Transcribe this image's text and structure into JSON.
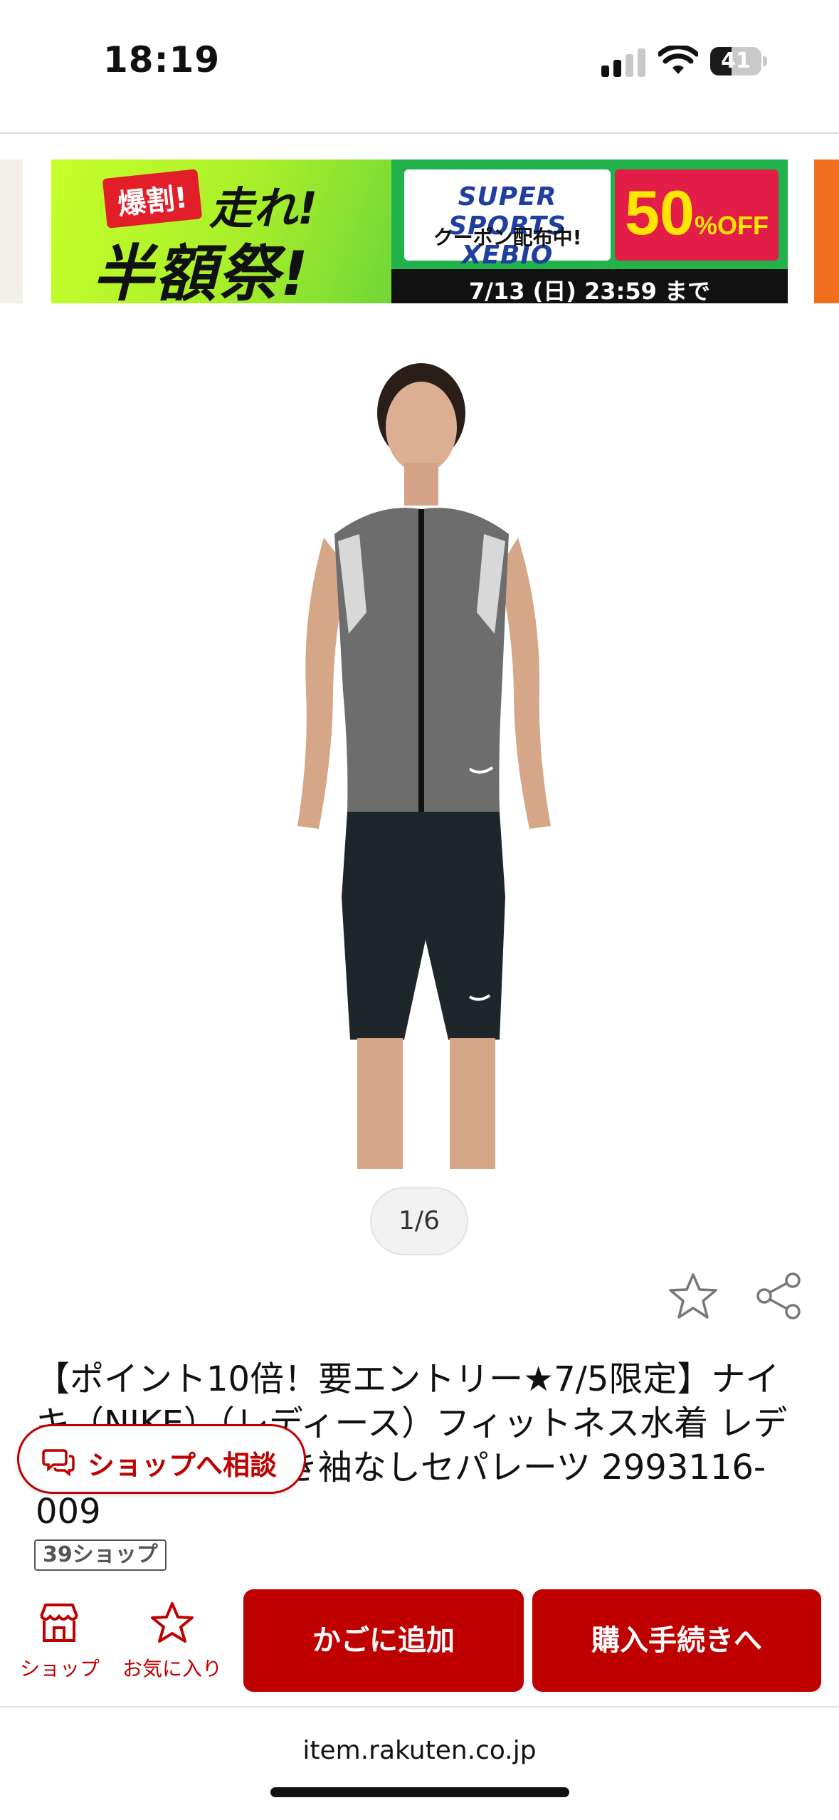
{
  "status_bar": {
    "time": "18:19",
    "battery": "41",
    "battery_level": 0.41,
    "icons": [
      "cellular-signal-icon",
      "wifi-icon",
      "battery-icon"
    ]
  },
  "banner": {
    "tag": "爆割!",
    "headline": "走れ!",
    "subheadline": "半額祭!",
    "brand": "SUPER SPORTS XEBIO",
    "coupon_text": "クーポン配布中!",
    "discount": "50",
    "discount_unit": "%OFF",
    "deadline": "7/13 (日) 23:59 まで",
    "colors": {
      "green": "#21b24b",
      "red": "#e21e48",
      "yellow": "#ffe600"
    }
  },
  "gallery": {
    "pager": "1/6"
  },
  "product": {
    "title": "【ポイント10倍！要エントリー★7/5限定】ナイキ（NIKE）（レディース）フィットネス水着 レディース ジップ付き袖なしセパレーツ 2993116-009",
    "shop_badge": "39ショップ"
  },
  "actions": {
    "favorite_icon": "star-outline-icon",
    "share_icon": "share-icon",
    "consult_label": "ショップへ相談"
  },
  "bottom_bar": {
    "shop_label": "ショップ",
    "favorite_label": "お気に入り",
    "add_to_cart": "かごに追加",
    "checkout": "購入手続きへ",
    "accent_color": "#bf0000"
  },
  "browser": {
    "url": "item.rakuten.co.jp"
  }
}
